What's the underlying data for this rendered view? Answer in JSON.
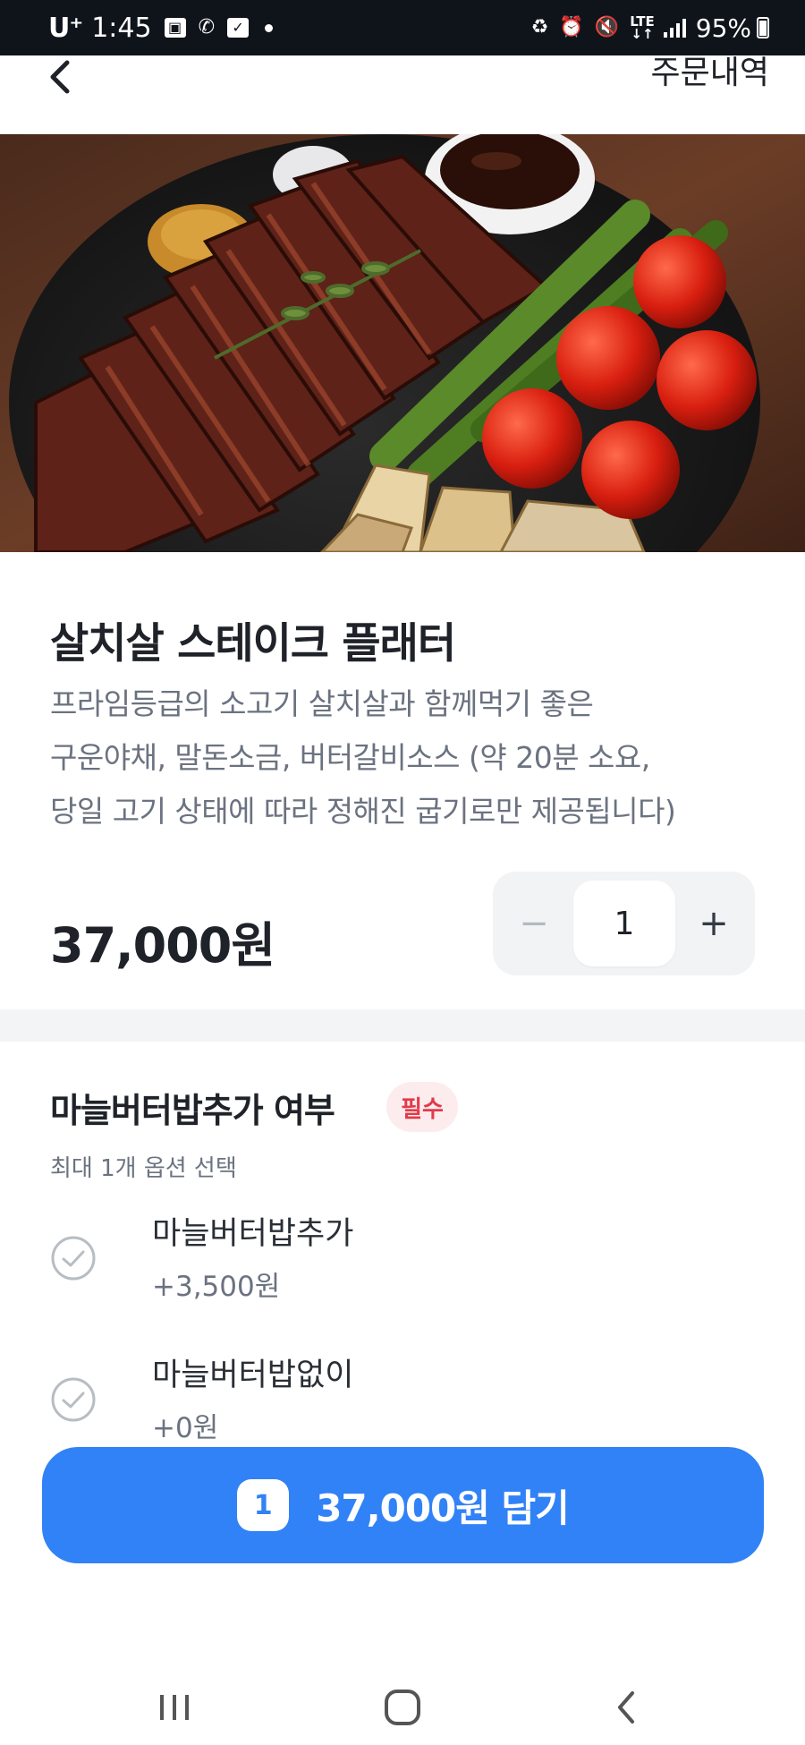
{
  "status_bar": {
    "carrier": "U⁺",
    "time": "1:45",
    "left_icons": [
      "image-icon",
      "call-app-icon",
      "checkbox-icon",
      "dot-icon"
    ],
    "right_icons": [
      "recycle-icon",
      "alarm-icon",
      "mute-icon",
      "lte-icon",
      "signal-icon"
    ],
    "network_label": "LTE",
    "battery": "95%"
  },
  "header": {
    "back_icon": "chevron-left-icon",
    "order_history_label": "주문내역"
  },
  "product": {
    "image_desc": "steak-platter-photo",
    "title": "살치살 스테이크 플래터",
    "description_lines": [
      "프라임등급의 소고기 살치살과 함께먹기 좋은",
      "구운야채, 말돈소금, 버터갈비소스 (약 20분 소요,",
      "당일 고기 상태에 따라 정해진 굽기로만 제공됩니다)"
    ],
    "price": "37,000원"
  },
  "quantity": {
    "minus_symbol": "−",
    "value": "1",
    "plus_symbol": "+"
  },
  "option_group": {
    "title": "마늘버터밥추가 여부",
    "badge": "필수",
    "subtitle": "최대 1개 옵션 선택",
    "options": [
      {
        "name": "마늘버터밥추가",
        "price": "+3,500원",
        "selected": false
      },
      {
        "name": "마늘버터밥없이",
        "price": "+0원",
        "selected": false
      }
    ]
  },
  "cta": {
    "count": "1",
    "label": "37,000원 담기"
  },
  "colors": {
    "accent": "#3182f6",
    "required": "#e23b4a",
    "status_bar_bg": "#0f141b"
  },
  "nav_bar": {
    "icons": [
      "recents-icon",
      "home-icon",
      "back-icon"
    ]
  }
}
